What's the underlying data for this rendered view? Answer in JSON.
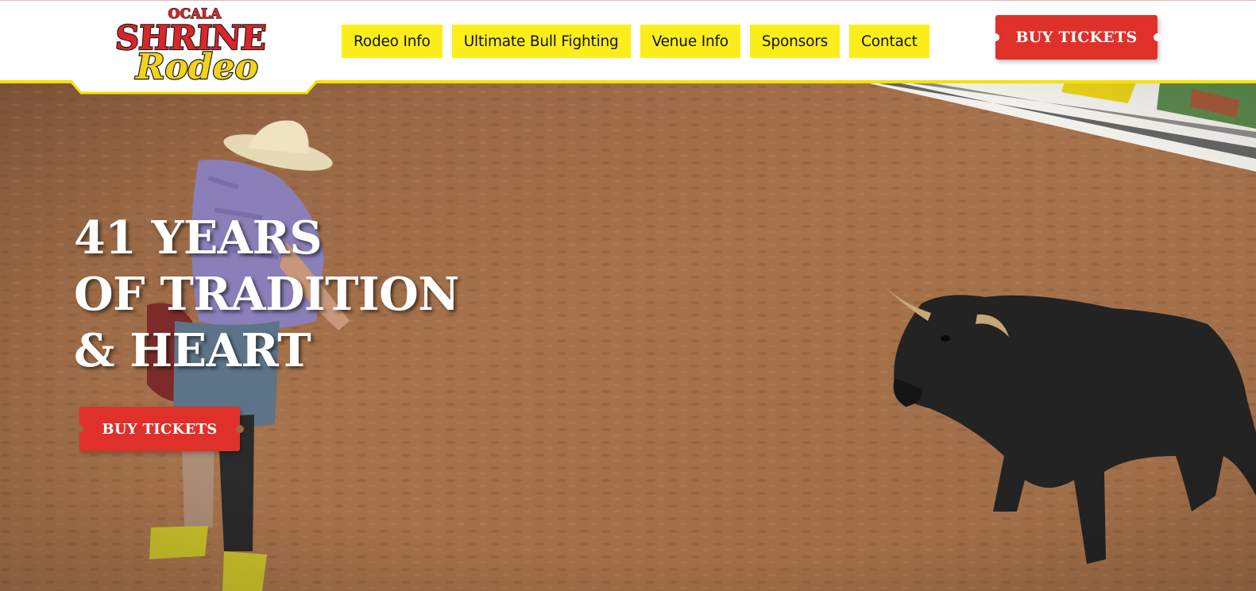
{
  "logo": {
    "line1": "OCALA",
    "line2": "SHRINE",
    "line3": "Rodeo"
  },
  "nav": {
    "items": [
      {
        "label": "Rodeo Info"
      },
      {
        "label": "Ultimate Bull Fighting"
      },
      {
        "label": "Venue Info"
      },
      {
        "label": "Sponsors"
      },
      {
        "label": "Contact"
      }
    ]
  },
  "header_cta": {
    "label": "BUY TICKETS"
  },
  "hero": {
    "headline_lines": [
      "41 YEARS",
      "OF TRADITION",
      "& HEART"
    ],
    "cta_label": "BUY TICKETS",
    "image_description_icon": "bullfighter-and-bull-photo"
  },
  "colors": {
    "nav_bg": "#fbee1a",
    "accent_red": "#e0302a",
    "dirt": "#9a6a45",
    "yellow_line": "#f4e200"
  }
}
